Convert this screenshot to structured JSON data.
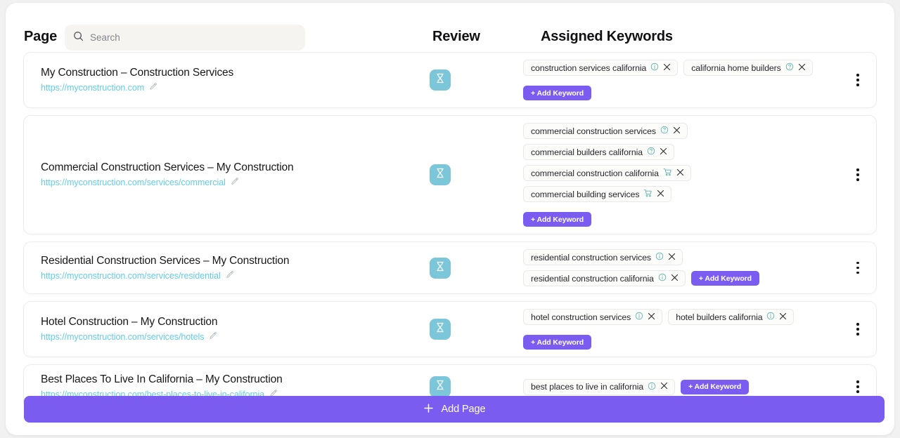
{
  "header": {
    "page_column_label": "Page",
    "review_column_label": "Review",
    "keywords_column_label": "Assigned Keywords",
    "search_placeholder": "Search",
    "search_value": ""
  },
  "colors": {
    "accent_purple": "#7b5cf0",
    "review_badge_blue": "#7cc6d9",
    "url_blue": "#63cdea",
    "chip_icon_teal": "#58b4a8",
    "page_background": "#f1f1f2"
  },
  "footer": {
    "add_page_label": "Add Page",
    "add_page_icon": "plus-icon"
  },
  "common": {
    "add_keyword_label": "+ Add Keyword",
    "review_icon": "hourglass-icon",
    "edit_icon": "pencil-icon",
    "menu_icon": "kebab-menu-icon",
    "close_icon": "close-icon"
  },
  "rows": [
    {
      "title": "My Construction – Construction Services",
      "url": "https://myconstruction.com",
      "review_status": "pending",
      "keywords": [
        {
          "text": "construction services california",
          "icon": "info-circle-icon"
        },
        {
          "text": "california home builders",
          "icon": "question-circle-icon"
        }
      ],
      "add_keyword_on_new_line": true
    },
    {
      "title": "Commercial Construction Services – My Construction",
      "url": "https://myconstruction.com/services/commercial",
      "review_status": "pending",
      "keywords": [
        {
          "text": "commercial construction services",
          "icon": "question-circle-icon"
        },
        {
          "text": "commercial builders california",
          "icon": "question-circle-icon"
        },
        {
          "text": "commercial construction california",
          "icon": "shopping-cart-icon"
        },
        {
          "text": "commercial building services",
          "icon": "shopping-cart-icon"
        }
      ],
      "add_keyword_on_new_line": true
    },
    {
      "title": "Residential Construction Services – My Construction",
      "url": "https://myconstruction.com/services/residential",
      "review_status": "pending",
      "keywords": [
        {
          "text": "residential construction services",
          "icon": "info-circle-icon"
        },
        {
          "text": "residential construction california",
          "icon": "info-circle-icon"
        }
      ],
      "add_keyword_on_new_line": false
    },
    {
      "title": "Hotel Construction – My Construction",
      "url": "https://myconstruction.com/services/hotels",
      "review_status": "pending",
      "keywords": [
        {
          "text": "hotel construction services",
          "icon": "info-circle-icon"
        },
        {
          "text": "hotel builders california",
          "icon": "info-circle-icon"
        }
      ],
      "add_keyword_on_new_line": true
    },
    {
      "title": "Best Places To Live In California – My Construction",
      "url": "https://myconstruction.com/best-places-to-live-in-california",
      "review_status": "pending",
      "keywords": [
        {
          "text": "best places to live in california",
          "icon": "info-circle-icon"
        }
      ],
      "add_keyword_on_new_line": false
    }
  ]
}
